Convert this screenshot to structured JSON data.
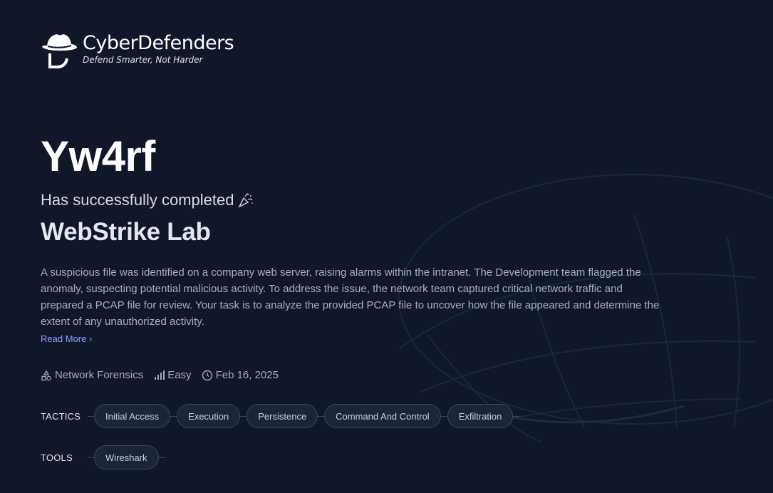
{
  "brand": {
    "name": "CyberDefenders",
    "tagline": "Defend Smarter, Not Harder"
  },
  "certificate": {
    "username": "Yw4rf",
    "completed_text": "Has successfully completed",
    "lab_name": "WebStrike Lab",
    "description": "A suspicious file was identified on a company web server, raising alarms within the intranet. The Development team flagged the anomaly, suspecting potential malicious activity. To address the issue, the network team captured critical network traffic and prepared a PCAP file for review. Your task is to analyze the provided PCAP file to uncover how the file appeared and determine the extent of any unauthorized activity.",
    "read_more": "Read More ›"
  },
  "meta": {
    "category": "Network Forensics",
    "difficulty": "Easy",
    "date": "Feb 16, 2025"
  },
  "tactics": {
    "label": "TACTICS",
    "items": [
      "Initial Access",
      "Execution",
      "Persistence",
      "Command And Control",
      "Exfiltration"
    ]
  },
  "tools": {
    "label": "TOOLS",
    "items": [
      "Wireshark"
    ]
  },
  "colors": {
    "background": "#0f1729",
    "accent_link": "#8ea2ff",
    "chip_border": "#3c475b"
  }
}
